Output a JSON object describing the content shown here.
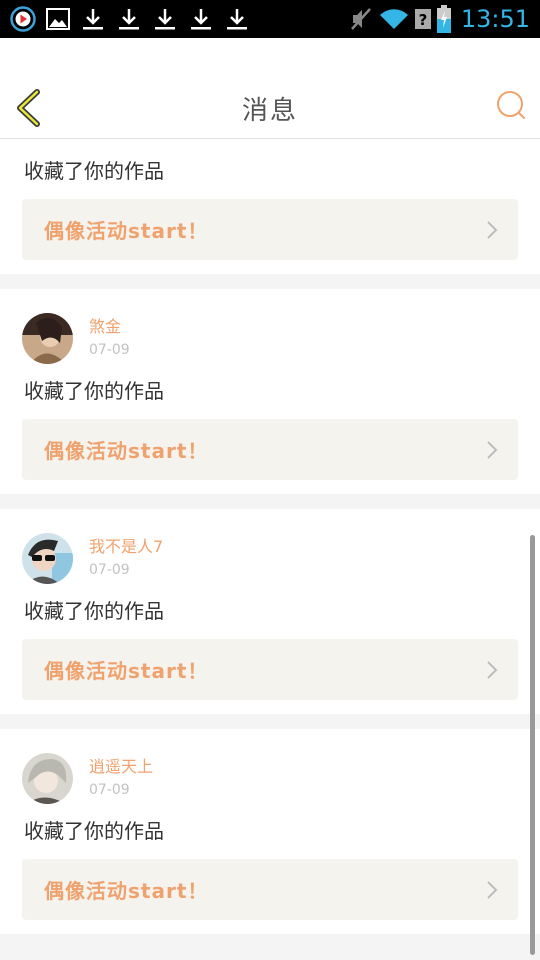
{
  "status_bar": {
    "time": "13:51",
    "icons": [
      "media-play-icon",
      "image-icon",
      "download-icon",
      "download-icon",
      "download-icon",
      "download-icon",
      "download-icon",
      "mute-icon",
      "wifi-icon",
      "unknown-sim-icon",
      "battery-charging-icon"
    ]
  },
  "header": {
    "title": "消息",
    "back_icon": "chevron-left-icon",
    "search_icon": "search-icon",
    "accent": "#f0a26e"
  },
  "feed": {
    "first": {
      "action": "收藏了你的作品",
      "link": "偶像活动start！"
    },
    "items": [
      {
        "username": "煞金",
        "date": "07-09",
        "action": "收藏了你的作品",
        "link": "偶像活动start！"
      },
      {
        "username": "我不是人7",
        "date": "07-09",
        "action": "收藏了你的作品",
        "link": "偶像活动start！"
      },
      {
        "username": "逍遥天上",
        "date": "07-09",
        "action": "收藏了你的作品",
        "link": "偶像活动start！"
      }
    ]
  }
}
